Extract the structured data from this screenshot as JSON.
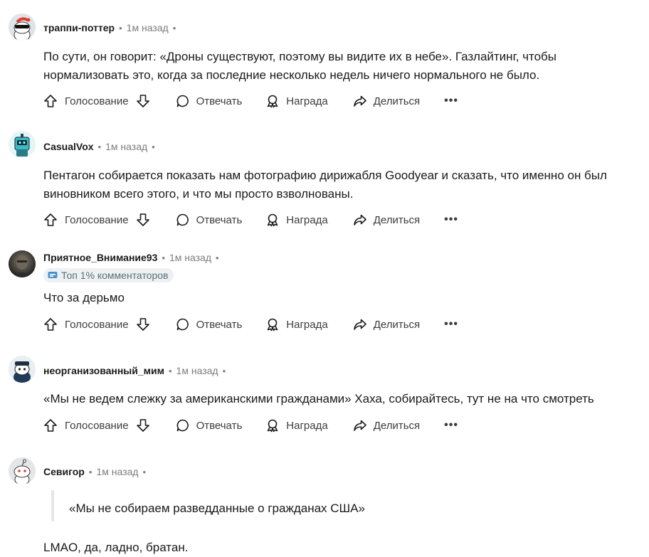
{
  "actions": {
    "upvote": "Голосование",
    "reply": "Отвечать",
    "award": "Награда",
    "share": "Делиться",
    "more": "•••"
  },
  "comments": [
    {
      "author": "траппи-поттер",
      "time": "1м назад",
      "body": "По сути, он говорит: «Дроны существуют, поэтому вы видите их в небе». Газлайтинг, чтобы нормализовать это, когда за последние несколько недель ничего нормального не было."
    },
    {
      "author": "CasualVox",
      "time": "1м назад",
      "body": "Пентагон собирается показать нам фотографию дирижабля Goodyear и сказать, что именно он был виновником всего этого, и что мы просто взволнованы."
    },
    {
      "author": "Приятное_Внимание93",
      "time": "1м назад",
      "badge": "Топ 1% комментаторов",
      "body": "Что за дерьмо"
    },
    {
      "author": "неорганизованный_мим",
      "time": "1м назад",
      "body": "«Мы не ведем слежку за американскими гражданами» Хаха, собирайтесь, тут не на что смотреть"
    },
    {
      "author": "Севигор",
      "time": "1м назад",
      "quote": "«Мы не собираем разведданные о гражданах США»",
      "body": "LMAO, да, ладно, братан."
    }
  ],
  "icons": {
    "upvote": "arrow-up-icon",
    "downvote": "arrow-down-icon",
    "reply": "speech-bubble-icon",
    "award": "award-icon",
    "share": "share-arrow-icon",
    "more": "ellipsis-icon"
  }
}
